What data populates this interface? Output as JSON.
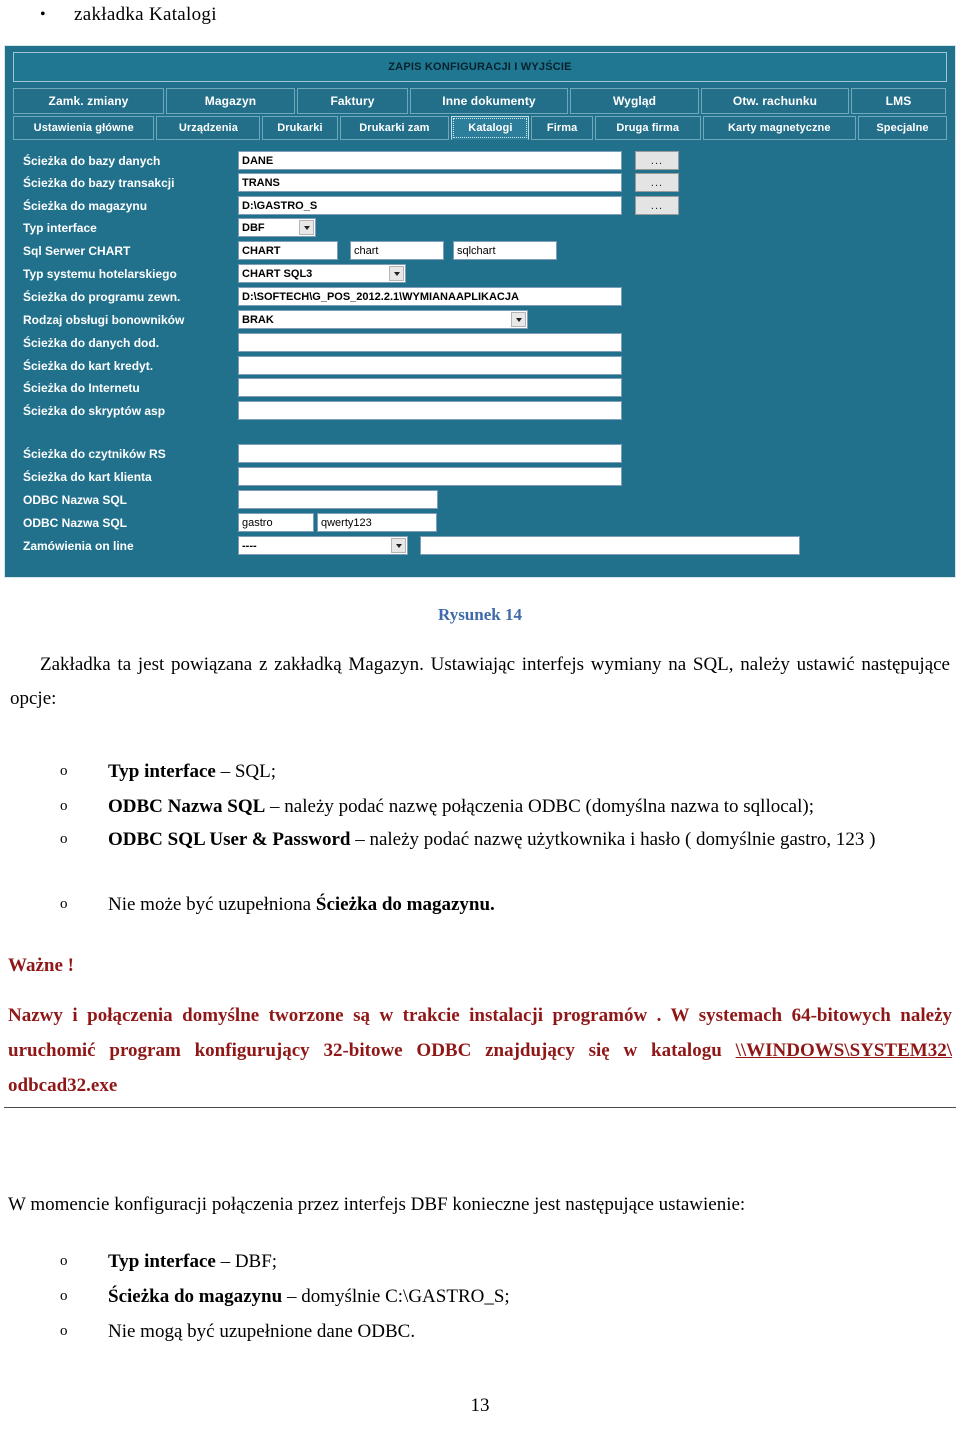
{
  "heading": {
    "bullet": "•",
    "text": "zakładka Katalogi"
  },
  "screenshot": {
    "title": "ZAPIS KONFIGURACJI I WYJŚCIE",
    "colors": {
      "panel_teal": "#22718c",
      "tab_teal": "#236f89",
      "selected_tab": "#2d7e9a"
    },
    "tabs_row1": [
      {
        "label": "Zamk. zmiany",
        "selected": false
      },
      {
        "label": "Magazyn",
        "selected": false
      },
      {
        "label": "Faktury",
        "selected": false
      },
      {
        "label": "Inne dokumenty",
        "selected": false
      },
      {
        "label": "Wygląd",
        "selected": false
      },
      {
        "label": "Otw. rachunku",
        "selected": false
      },
      {
        "label": "LMS",
        "selected": false
      }
    ],
    "tabs_row2": [
      {
        "label": "Ustawienia główne",
        "selected": false
      },
      {
        "label": "Urządzenia",
        "selected": false
      },
      {
        "label": "Drukarki",
        "selected": false
      },
      {
        "label": "Drukarki zam",
        "selected": false
      },
      {
        "label": "Katalogi",
        "selected": true
      },
      {
        "label": "Firma",
        "selected": false
      },
      {
        "label": "Druga firma",
        "selected": false
      },
      {
        "label": "Karty magnetyczne",
        "selected": false
      },
      {
        "label": "Specjalne",
        "selected": false
      }
    ],
    "fields": [
      {
        "label": "Ścieżka do bazy danych",
        "value": "DANE",
        "browse": "..."
      },
      {
        "label": "Ścieżka do bazy transakcji",
        "value": "TRANS",
        "browse": "..."
      },
      {
        "label": "Ścieżka do magazynu",
        "value": "D:\\GASTRO_S",
        "browse": "..."
      },
      {
        "label": "Typ interface",
        "value": "DBF"
      },
      {
        "label": "Sql Serwer CHART",
        "value": "CHART",
        "value2": "chart",
        "value3": "sqlchart"
      },
      {
        "label": "Typ systemu hotelarskiego",
        "value": "CHART SQL3"
      },
      {
        "label": "Ścieżka do programu zewn.",
        "value": "D:\\SOFTECH\\G_POS_2012.2.1\\WYMIANAAPLIKACJA"
      },
      {
        "label": "Rodzaj obsługi bonowników",
        "value": "BRAK"
      },
      {
        "label": "Ścieżka do danych dod.",
        "value": ""
      },
      {
        "label": "Ścieżka do kart kredyt.",
        "value": ""
      },
      {
        "label": "Ścieżka do Internetu",
        "value": ""
      },
      {
        "label": "Ścieżka do skryptów asp",
        "value": ""
      },
      {
        "label": "Ścieżka do czytników RS",
        "value": ""
      },
      {
        "label": "Ścieżka do kart klienta",
        "value": ""
      },
      {
        "label": "ODBC Nazwa SQL",
        "value": ""
      },
      {
        "label": "ODBC Nazwa SQL",
        "value": "gastro",
        "value2": "qwerty123"
      },
      {
        "label": "Zamówienia on line",
        "value": "----",
        "value2": ""
      }
    ]
  },
  "caption": "Rysunek 14",
  "intro": {
    "line": "Zakładka ta jest powiązana z zakładką Magazyn. Ustawiając interfejs wymiany na SQL, należy ustawić następujące opcje:"
  },
  "sql_list": {
    "marker": "o",
    "items": [
      {
        "bold": "Typ interface",
        "rest": " – SQL;"
      },
      {
        "bold": "ODBC Nazwa SQL",
        "rest": " – należy podać nazwę połączenia ODBC (domyślna nazwa to sqllocal);"
      },
      {
        "bold": "ODBC SQL User & Password",
        "rest": " – należy podać nazwę użytkownika i hasło ( domyślnie gastro, 123 )"
      },
      {
        "bold": "",
        "rest": "Nie może być uzupełniona ",
        "bold_tail": "Ścieżka do magazynu."
      }
    ]
  },
  "warning": {
    "title": "Ważne !",
    "body_before": "Nazwy i połączenia domyślne tworzone są w trakcie instalacji programów . W systemach 64-bitowych należy uruchomić program konfigurujący 32-bitowe ODBC znajdujący się w katalogu ",
    "path": "\\\\WINDOWS\\SYSTEM32\\",
    "body_after": " odbcad32.exe"
  },
  "dbf": {
    "intro": "W momencie konfiguracji połączenia przez interfejs DBF konieczne jest następujące ustawienie:",
    "marker": "o",
    "items": [
      {
        "bold": "Typ interface",
        "rest": " – DBF;"
      },
      {
        "bold": "Ścieżka do magazynu",
        "rest": " – domyślnie C:\\GASTRO_S;"
      },
      {
        "bold": "",
        "rest": "Nie mogą być uzupełnione dane ODBC."
      }
    ]
  },
  "page_number": "13"
}
